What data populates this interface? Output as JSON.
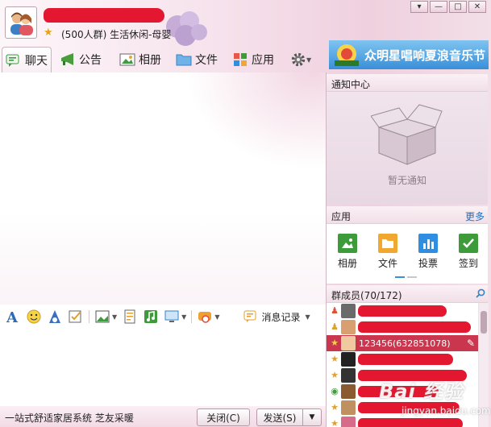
{
  "header": {
    "group_info": "(500人群) 生活休闲-母婴",
    "window_controls": [
      "▾",
      "—",
      "□",
      "✕"
    ]
  },
  "tabs": [
    {
      "label": "聊天",
      "icon": "chat-icon",
      "active": true
    },
    {
      "label": "公告",
      "icon": "megaphone-icon"
    },
    {
      "label": "相册",
      "icon": "album-icon"
    },
    {
      "label": "文件",
      "icon": "folder-icon"
    },
    {
      "label": "应用",
      "icon": "apps-icon"
    }
  ],
  "banner": {
    "text": "众明星唱响夏浪音乐节"
  },
  "toolbar": {
    "history_label": "消息记录"
  },
  "bottom": {
    "ad_text": "一站式舒适家居系统 芝友采暖",
    "close_label": "关闭(C)",
    "send_label": "发送(S)"
  },
  "notice": {
    "title": "通知中心",
    "empty_text": "暂无通知"
  },
  "apps": {
    "title": "应用",
    "more_label": "更多",
    "items": [
      {
        "label": "相册",
        "color": "#3e9b3a"
      },
      {
        "label": "文件",
        "color": "#f0a830"
      },
      {
        "label": "投票",
        "color": "#2f8ee0"
      },
      {
        "label": "签到",
        "color": "#3e9b3a"
      }
    ]
  },
  "members": {
    "title": "群成员(70/172)",
    "selected_name": "123456(632851078)"
  },
  "watermark": {
    "text": "Bai 经验",
    "sub": "jingyan.baidu.com"
  },
  "colors": {
    "accent": "#c9364e",
    "redaction": "#e3172f",
    "link": "#1a6fc4"
  }
}
